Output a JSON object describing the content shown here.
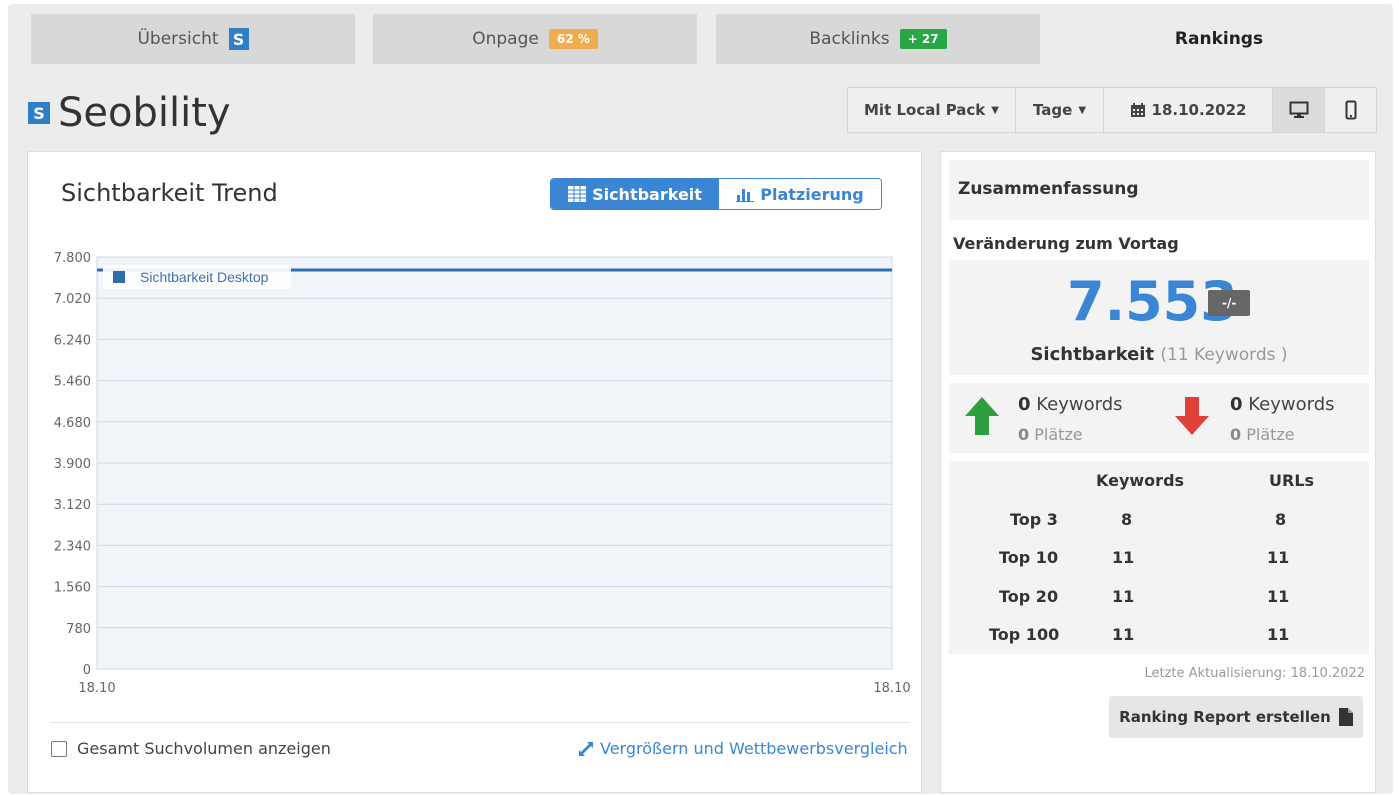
{
  "tabs": [
    {
      "label": "Übersicht",
      "badge": ""
    },
    {
      "label": "Onpage",
      "badge": "62 %"
    },
    {
      "label": "Backlinks",
      "badge": "+ 27"
    },
    {
      "label": "Rankings",
      "badge": ""
    }
  ],
  "logo": {
    "mark": "S",
    "text": "Seobility"
  },
  "toolbar": {
    "local_pack": "Mit Local Pack",
    "period": "Tage",
    "date": "18.10.2022",
    "desktop_icon": "desktop-icon",
    "mobile_icon": "mobile-icon"
  },
  "chart_panel": {
    "title": "Sichtbarkeit Trend",
    "toggle_visibility": "Sichtbarkeit",
    "toggle_placement": "Platzierung",
    "checkbox_label": "Gesamt Suchvolumen anzeigen",
    "enlarge_link": "Vergrößern und Wettbewerbsvergleich"
  },
  "chart_data": {
    "type": "line",
    "title": "",
    "xlabel": "",
    "ylabel": "",
    "x": [
      "18.10",
      "18.10"
    ],
    "series": [
      {
        "name": "Sichtbarkeit Desktop",
        "values": [
          7553,
          7553
        ]
      }
    ],
    "ylim": [
      0,
      7800
    ],
    "yticks": [
      "7.800",
      "7.020",
      "6.240",
      "5.460",
      "4.680",
      "3.900",
      "3.120",
      "2.340",
      "1.560",
      "780",
      "0"
    ],
    "grid": true,
    "legend_position": "top-left",
    "colors": {
      "series": "#2f6db0",
      "fill": "#f1f5f9"
    }
  },
  "summary": {
    "title": "Zusammenfassung",
    "subtitle": "Veränderung zum Vortag",
    "value": "7.553",
    "change_badge": "-/-",
    "value_label": "Sichtbarkeit",
    "value_note": "(11 Keywords )",
    "up": {
      "keywords_num": "0",
      "keywords_label": "Keywords",
      "places_num": "0",
      "places_label": "Plätze"
    },
    "down": {
      "keywords_num": "0",
      "keywords_label": "Keywords",
      "places_num": "0",
      "places_label": "Plätze"
    },
    "table": {
      "headers": [
        "Keywords",
        "URLs"
      ],
      "rows": [
        {
          "label": "Top 3",
          "keywords": "8",
          "urls": "8"
        },
        {
          "label": "Top 10",
          "keywords": "11",
          "urls": "11"
        },
        {
          "label": "Top 20",
          "keywords": "11",
          "urls": "11"
        },
        {
          "label": "Top 100",
          "keywords": "11",
          "urls": "11"
        }
      ]
    },
    "last_update": "Letzte Aktualisierung: 18.10.2022",
    "report_button": "Ranking Report erstellen"
  },
  "colors": {
    "accent": "#3a86d4",
    "onpage_badge": "#f0ad4e",
    "backlinks_badge": "#28a745",
    "up": "#2e9e3e",
    "down": "#e0413a"
  }
}
